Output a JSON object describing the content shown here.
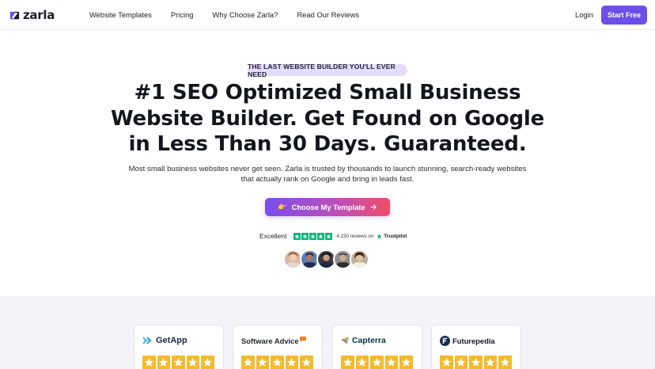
{
  "nav": {
    "logo_text": "zarla",
    "links": [
      "Website Templates",
      "Pricing",
      "Why Choose Zarla?",
      "Read Our Reviews"
    ],
    "login": "Login",
    "start_button": "Start Free"
  },
  "hero": {
    "badge": "THE LAST WEBSITE BUILDER YOU'LL EVER NEED",
    "headline_lines": [
      "#1 SEO Optimized Small Business",
      "Website Builder. Get Found on Google",
      "in Less Than 30 Days. Guaranteed."
    ],
    "subtext_lines": [
      "Most small business websites never get seen. Zarla is trusted by thousands to launch stunning, search-ready websites",
      "that actually rank on Google and bring in leads fast."
    ],
    "cta_label": "Choose My Template",
    "cta_icon": "pointing-hand-icon"
  },
  "trustpilot": {
    "rating_word": "Excellent",
    "stars": 5,
    "review_count": "4,150 reviews on",
    "brand": "Trustpilot",
    "star_color": "#00b67a"
  },
  "avatars_count": 5,
  "review_cards": [
    {
      "brand": "GetApp",
      "icon": "getapp-chevrons-icon",
      "stars": 5
    },
    {
      "brand": "Software Advice",
      "icon": "software-advice-speech-icon",
      "stars": 5
    },
    {
      "brand": "Capterra",
      "icon": "capterra-arrow-icon",
      "stars": 5
    },
    {
      "brand": "Futurepedia",
      "icon": "futurepedia-f-icon",
      "stars": 5
    }
  ],
  "colors": {
    "accent": "#6b4fe8",
    "badge_bg": "#e4dcfb",
    "review_star": "#f4ba2f",
    "lower_bg": "#f4f4f8"
  }
}
